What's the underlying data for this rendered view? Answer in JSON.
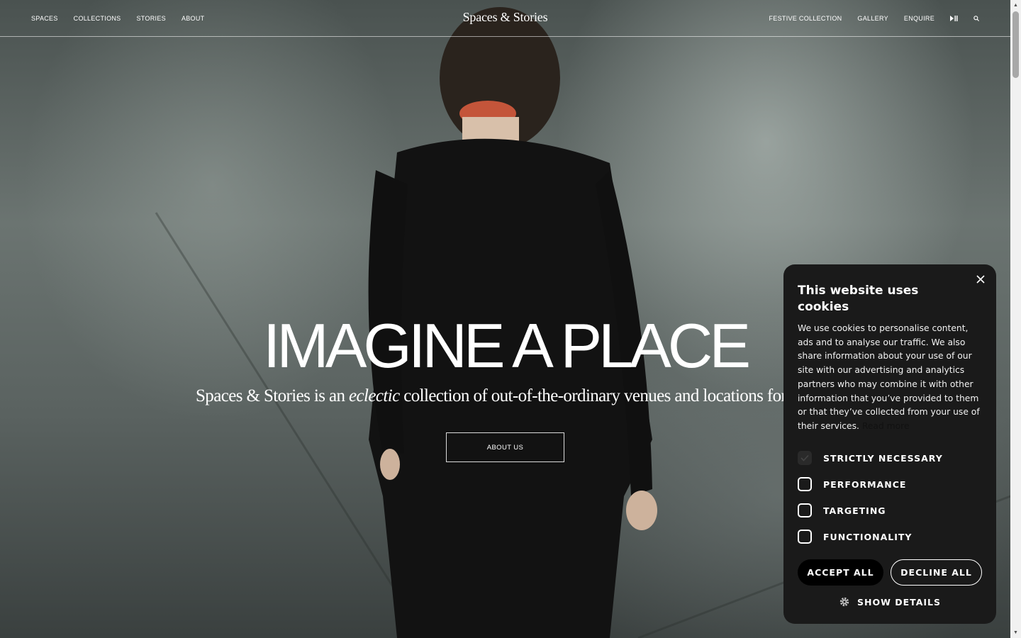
{
  "header": {
    "nav_left": [
      "SPACES",
      "COLLECTIONS",
      "STORIES",
      "ABOUT"
    ],
    "logo": "Spaces & Stories",
    "nav_right": [
      "FESTIVE COLLECTION",
      "GALLERY",
      "ENQUIRE"
    ],
    "play_pause_icon": "play-pause-icon",
    "search_icon": "search-icon"
  },
  "hero": {
    "headline": "IMAGINE A PLACE",
    "tagline_before": "Spaces & Stories is an ",
    "tagline_emphasis": "eclectic",
    "tagline_after": " collection of out-of-the-ordinary venues and locations for",
    "button_label": "ABOUT US"
  },
  "cookie_banner": {
    "title": "This website uses cookies",
    "description": "We use cookies to personalise content, ads and to analyse our traffic. We also share information about your use of our site with our advertising and analytics partners who may combine it with other information that you’ve provided to them or that they’ve collected from your use of their services. ",
    "read_more": "Read more",
    "options": [
      {
        "label": "STRICTLY NECESSARY",
        "checked": true
      },
      {
        "label": "PERFORMANCE",
        "checked": false
      },
      {
        "label": "TARGETING",
        "checked": false
      },
      {
        "label": "FUNCTIONALITY",
        "checked": false
      }
    ],
    "accept_label": "ACCEPT ALL",
    "decline_label": "DECLINE ALL",
    "show_details_label": "SHOW DETAILS",
    "close_icon": "close-icon",
    "gear_icon": "gear-icon"
  },
  "colors": {
    "modal_bg": "#1a1a1a",
    "accent": "#000000",
    "text": "#ffffff"
  }
}
